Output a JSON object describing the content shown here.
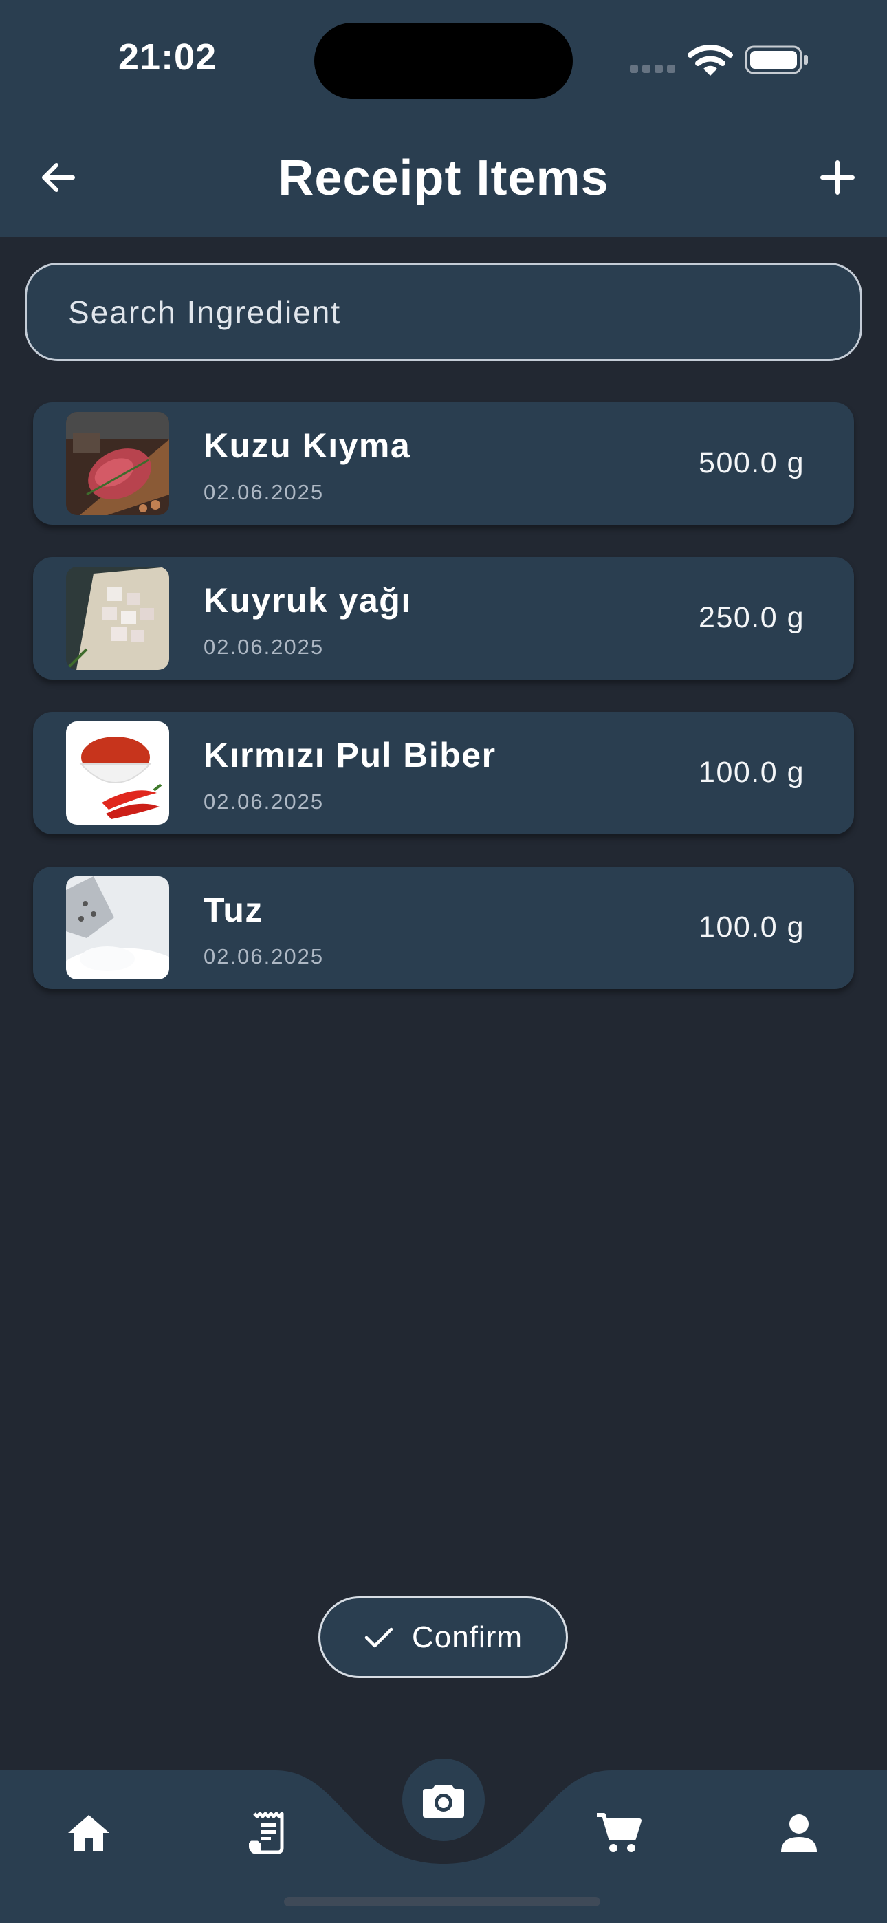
{
  "status_bar": {
    "time": "21:02"
  },
  "header": {
    "title": "Receipt Items",
    "back_icon": "arrow-left-icon",
    "add_icon": "plus-icon"
  },
  "search": {
    "placeholder": "Search Ingredient",
    "value": ""
  },
  "items": [
    {
      "name": "Kuzu Kıyma",
      "date": "02.06.2025",
      "quantity": "500.0 g",
      "image": "minced-lamb"
    },
    {
      "name": "Kuyruk yağı",
      "date": "02.06.2025",
      "quantity": "250.0 g",
      "image": "tail-fat"
    },
    {
      "name": "Kırmızı Pul Biber",
      "date": "02.06.2025",
      "quantity": "100.0 g",
      "image": "red-pepper-flakes"
    },
    {
      "name": "Tuz",
      "date": "02.06.2025",
      "quantity": "100.0 g",
      "image": "salt"
    }
  ],
  "confirm": {
    "label": "Confirm",
    "icon": "check-icon"
  },
  "bottom_nav": {
    "items": [
      "home-icon",
      "receipt-icon",
      "camera-icon",
      "cart-icon",
      "person-icon"
    ]
  },
  "colors": {
    "background": "#222832",
    "surface": "#2a3e50",
    "text": "#ffffff"
  }
}
